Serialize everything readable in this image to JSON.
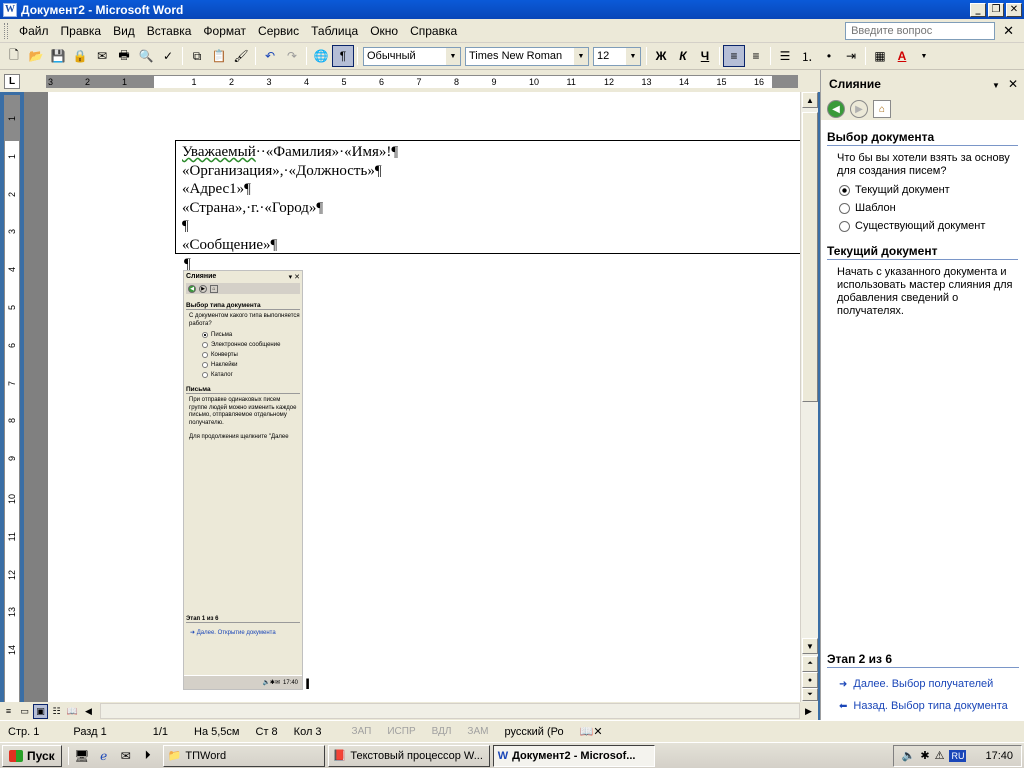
{
  "window": {
    "title": "Документ2 - Microsoft Word",
    "app_icon": "W",
    "btn_min": "_",
    "btn_max": "❐",
    "btn_close": "✕"
  },
  "menu": {
    "items": [
      "Файл",
      "Правка",
      "Вид",
      "Вставка",
      "Формат",
      "Сервис",
      "Таблица",
      "Окно",
      "Справка"
    ],
    "ask_placeholder": "Введите вопрос",
    "close": "✕"
  },
  "toolbar": {
    "style_value": "Обычный",
    "font_value": "Times New Roman",
    "size_value": "12",
    "bold": "Ж",
    "italic": "К",
    "underline": "Ч",
    "pilcrow": "¶",
    "font_color_label": "A"
  },
  "ruler": {
    "tab_box": "L",
    "h_numbers": [
      "3",
      "2",
      "1",
      "1",
      "2",
      "3",
      "4",
      "5",
      "6",
      "7",
      "8",
      "9",
      "10",
      "11",
      "12",
      "13",
      "14",
      "15",
      "16"
    ],
    "v_numbers": [
      "1",
      "1",
      "2",
      "3",
      "4",
      "5",
      "6",
      "7",
      "8",
      "9",
      "10",
      "11",
      "12",
      "13",
      "14"
    ]
  },
  "document": {
    "lines": [
      "Уважаемый··«Фамилия»·«Имя»!¶",
      "«Организация»,·«Должность»¶",
      "«Адрес1»¶",
      "«Страна»,·г.·«Город»¶",
      "¶",
      "«Сообщение»¶"
    ],
    "first_word": "Уважаемый",
    "first_rest": "··«Фамилия»·«Имя»!¶",
    "after_box": "¶"
  },
  "embedded": {
    "title": "Слияние",
    "heading1": "Выбор типа документа",
    "question": "С документом какого типа выполняется работа?",
    "options": [
      "Письма",
      "Электронное сообщение",
      "Конверты",
      "Наклейки",
      "Каталог"
    ],
    "selected_index": 0,
    "heading2": "Письма",
    "desc": "При отправке одинаковых писем группе людей можно изменить каждое письмо, отправляемое отдельному получателю.",
    "continue": "Для продолжения щелкните \"Далее",
    "step": "Этап 1 из 6",
    "next": "Далее. Открытие документа",
    "clock": "17:40"
  },
  "pane": {
    "title": "Слияние",
    "close": "✕",
    "dropdown": "▼",
    "section1": "Выбор документа",
    "question": "Что бы вы хотели взять за основу для создания писем?",
    "options": [
      "Текущий документ",
      "Шаблон",
      "Существующий документ"
    ],
    "selected_index": 0,
    "section2": "Текущий документ",
    "desc": "Начать с указанного документа и использовать мастер слияния для добавления сведений о получателях.",
    "step": "Этап 2 из 6",
    "next": "Далее. Выбор получателей",
    "back": "Назад. Выбор типа документа"
  },
  "status": {
    "page": "Стр. 1",
    "section": "Разд 1",
    "pages": "1/1",
    "at": "На 5,5см",
    "line": "Ст 8",
    "col": "Кол 3",
    "rec": "ЗАП",
    "trk": "ИСПР",
    "ext": "ВДЛ",
    "ovr": "ЗАМ",
    "lang": "русский (Ро"
  },
  "taskbar": {
    "start": "Пуск",
    "tasks": [
      "ТПWord",
      "Текстовый процессор W...",
      "Документ2 - Microsof..."
    ],
    "active_index": 2,
    "lang": "RU",
    "clock": "17:40"
  }
}
